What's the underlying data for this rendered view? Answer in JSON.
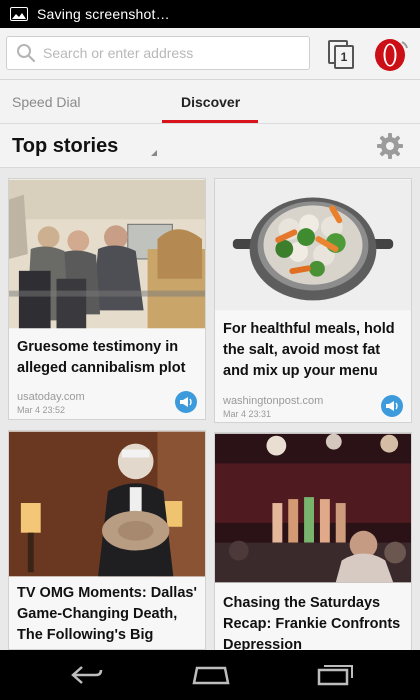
{
  "status": {
    "text": "Saving screenshot…",
    "icon": "picture-icon"
  },
  "address_bar": {
    "placeholder": "Search or enter address",
    "tab_count": "1"
  },
  "tabs": {
    "speed_dial": "Speed Dial",
    "discover": "Discover",
    "active": "Discover"
  },
  "section": {
    "title": "Top stories"
  },
  "cards": [
    {
      "headline": "Gruesome testimony in alleged cannibalism plot",
      "source": "usatoday.com",
      "date": "Mar 4 23:52"
    },
    {
      "headline": "For healthful meals, hold the salt, avoid most fat and mix up your menu",
      "source": "washingtonpost.com",
      "date": "Mar 4 23:31"
    },
    {
      "headline": "TV OMG Moments: Dallas' Game-Changing Death, The Following's Big Reveal and",
      "source": "",
      "date": ""
    },
    {
      "headline": "Chasing the Saturdays Recap: Frankie Confronts Depression",
      "source": "",
      "date": ""
    }
  ],
  "colors": {
    "accent": "#d8131c",
    "speaker": "#3d9bdc",
    "opera_red": "#cc0f16"
  }
}
